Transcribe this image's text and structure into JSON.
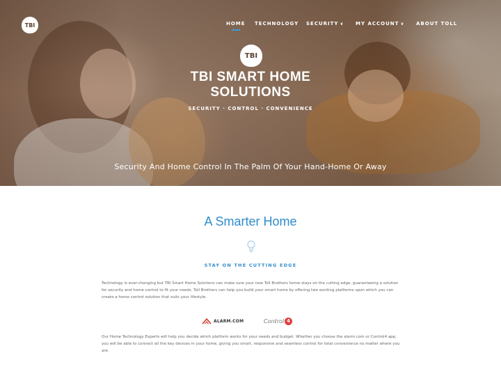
{
  "nav": {
    "logo_text": "TBI",
    "items": [
      {
        "label": "Home",
        "has_caret": false
      },
      {
        "label": "Technology",
        "has_caret": false
      },
      {
        "label": "Security",
        "has_caret": true
      },
      {
        "label": "My Account",
        "has_caret": true
      },
      {
        "label": "About Toll",
        "has_caret": false
      }
    ],
    "active_item": "Home",
    "caret_glyph": "∨"
  },
  "hero": {
    "badge_text": "TBI",
    "title_line1": "TBI Smart Home",
    "title_line2": "Solutions",
    "tagline": "Security · Control · Convenience",
    "caption": "Security And Home Control In The Palm Of Your Hand-Home Or Away"
  },
  "section": {
    "title": "A Smarter Home",
    "icon": "lightbulb-icon",
    "subtitle": "Stay on the cutting edge",
    "paragraph1": "Technology is ever-changing but TBI Smart Home Solutions can make sure your new Toll Brothers home stays on the cutting edge, guaranteeing a solution for security and home control to fit your needs. Toll Brothers can help you build your smart home by offering two exciting platforms upon which you can create a home control solution that suits your lifestyle.",
    "paragraph2": "Our Home Technology Experts will help you decide which platform works for your needs and budget. Whether you choose the alarm.com or Control4 app, you will be able to connect all the key devices in your home, giving you smart, responsive and seamless control for total convenience no matter where you are."
  },
  "partners": {
    "alarm_com": "ALARM.COM",
    "control4_text": "Control",
    "control4_mark": "4"
  },
  "colors": {
    "accent": "#2f8ccc",
    "nav_underline": "#3a9bd9",
    "control4_red": "#e04040",
    "alarm_red": "#d23a2a"
  }
}
